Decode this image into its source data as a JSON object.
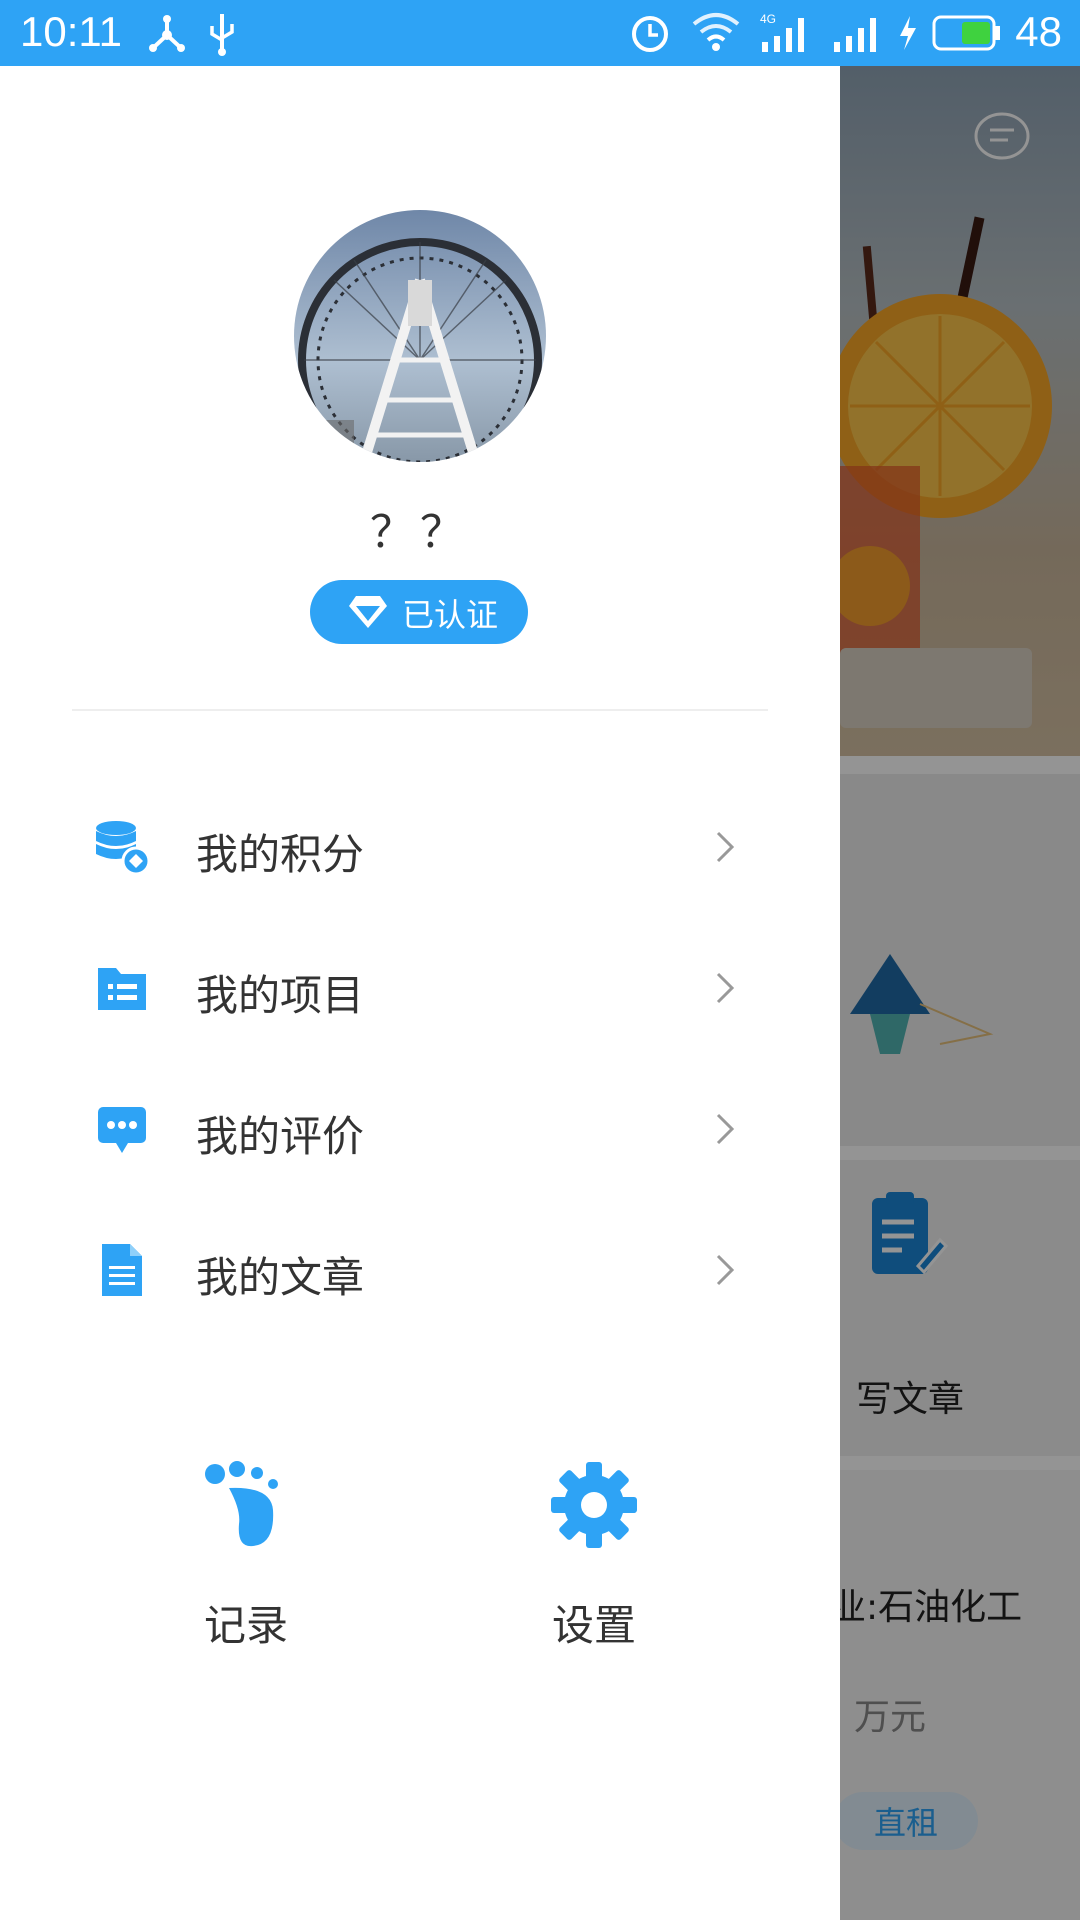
{
  "status_bar": {
    "time": "10:11",
    "battery_level": "48",
    "network": "4G"
  },
  "drawer": {
    "user": {
      "name": "？？",
      "badge": "已认证"
    },
    "menu": [
      {
        "label": "我的积分",
        "icon": "points-database-icon"
      },
      {
        "label": "我的项目",
        "icon": "project-folder-icon"
      },
      {
        "label": "我的评价",
        "icon": "comment-bubble-icon"
      },
      {
        "label": "我的文章",
        "icon": "document-icon"
      }
    ],
    "actions": [
      {
        "label": "记录",
        "icon": "footprint-icon"
      },
      {
        "label": "设置",
        "icon": "gear-icon"
      }
    ]
  },
  "background_app": {
    "write_article": "写文章",
    "industry": "业:石油化工",
    "amount_unit": "万元",
    "tag": "直租"
  },
  "colors": {
    "accent": "#2ea3f5",
    "text": "#333333"
  }
}
